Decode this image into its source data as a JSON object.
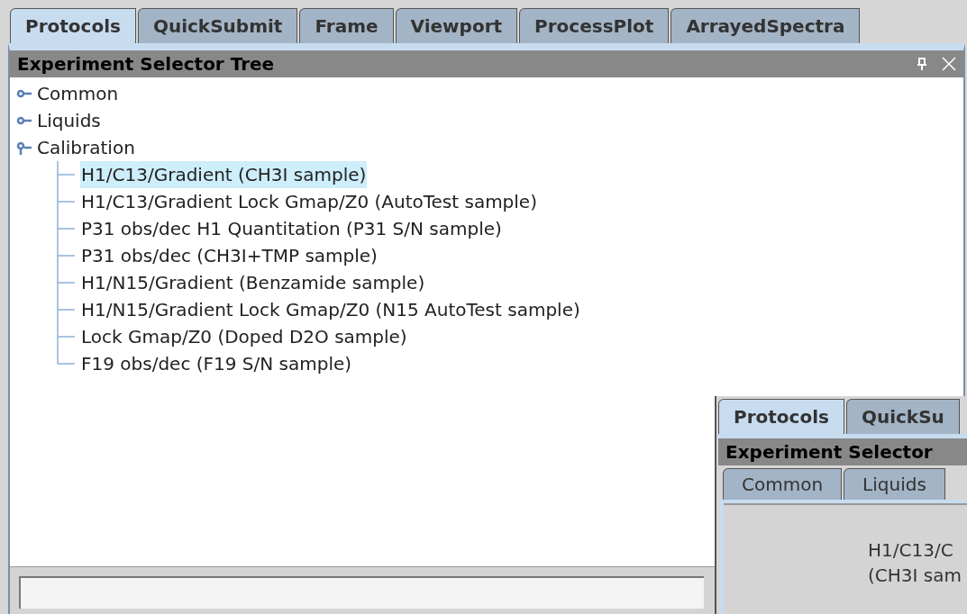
{
  "tabs": [
    {
      "label": "Protocols",
      "selected": true
    },
    {
      "label": "QuickSubmit",
      "selected": false
    },
    {
      "label": "Frame",
      "selected": false
    },
    {
      "label": "Viewport",
      "selected": false
    },
    {
      "label": "ProcessPlot",
      "selected": false
    },
    {
      "label": "ArrayedSpectra",
      "selected": false
    }
  ],
  "panel": {
    "title": "Experiment Selector Tree"
  },
  "tree": [
    {
      "label": "Common",
      "expanded": false
    },
    {
      "label": "Liquids",
      "expanded": false
    },
    {
      "label": "Calibration",
      "expanded": true,
      "children": [
        {
          "label": "H1/C13/Gradient (CH3I sample)",
          "selected": true
        },
        {
          "label": "H1/C13/Gradient Lock Gmap/Z0 (AutoTest sample)",
          "selected": false
        },
        {
          "label": "P31 obs/dec H1 Quantitation (P31 S/N sample)",
          "selected": false
        },
        {
          "label": "P31 obs/dec (CH3I+TMP sample)",
          "selected": false
        },
        {
          "label": "H1/N15/Gradient (Benzamide sample)",
          "selected": false
        },
        {
          "label": "H1/N15/Gradient Lock Gmap/Z0 (N15 AutoTest sample)",
          "selected": false
        },
        {
          "label": "Lock Gmap/Z0 (Doped D2O sample)",
          "selected": false
        },
        {
          "label": "F19 obs/dec (F19 S/N sample)",
          "selected": false
        }
      ]
    }
  ],
  "inset": {
    "tabs": [
      {
        "label": "Protocols",
        "selected": true
      },
      {
        "label": "QuickSu",
        "selected": false
      }
    ],
    "title": "Experiment Selector",
    "subtabs": [
      {
        "label": "Common",
        "selected": false
      },
      {
        "label": "Liquids",
        "selected": false
      }
    ],
    "text_lines": [
      "H1/C13/C",
      "(CH3I sam"
    ]
  }
}
